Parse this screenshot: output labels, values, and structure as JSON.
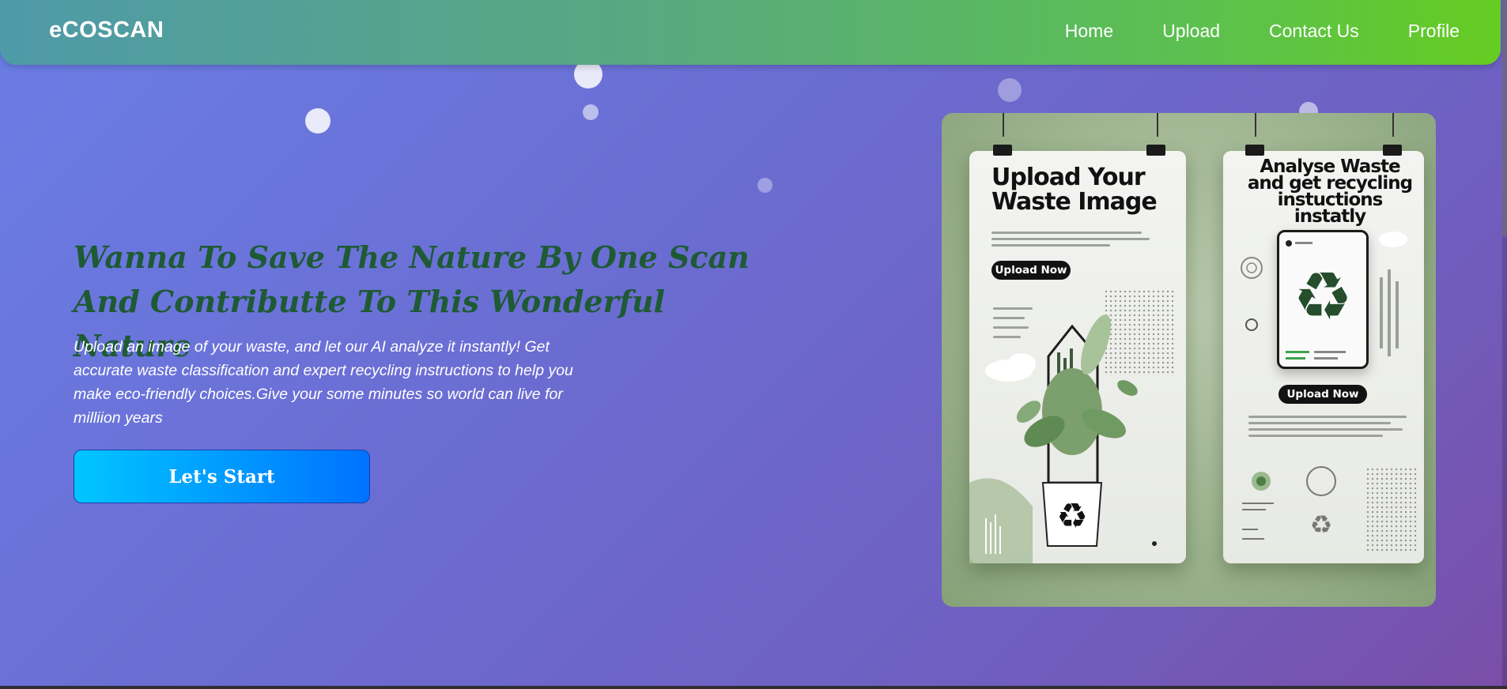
{
  "navbar": {
    "brand": "eCOSCAN",
    "links": [
      "Home",
      "Upload",
      "Contact Us",
      "Profile"
    ]
  },
  "hero": {
    "title_line1": "Wanna To Save The Nature By One Scan",
    "title_line2": "And Contributte To This Wonderful Nature",
    "description": "Upload an image of your waste, and let our AI analyze it instantly! Get accurate waste classification and expert recycling instructions to help you make eco-friendly choices.Give your some minutes so world can live for milliion years",
    "cta_label": "Let's Start"
  },
  "illustration": {
    "left_card_title": "Upload Your Waste Image",
    "left_card_button": "Upload Now",
    "right_card_title": "Analyse Waste and get recycling instuctions instatly",
    "right_card_button": "Upload Now",
    "background_color": "#9db48f"
  },
  "colors": {
    "nav_start": "#4f9aa8",
    "nav_end": "#65cc22",
    "title_color": "#1e5a34",
    "cta_start": "#00c6ff",
    "cta_end": "#0072ff"
  }
}
